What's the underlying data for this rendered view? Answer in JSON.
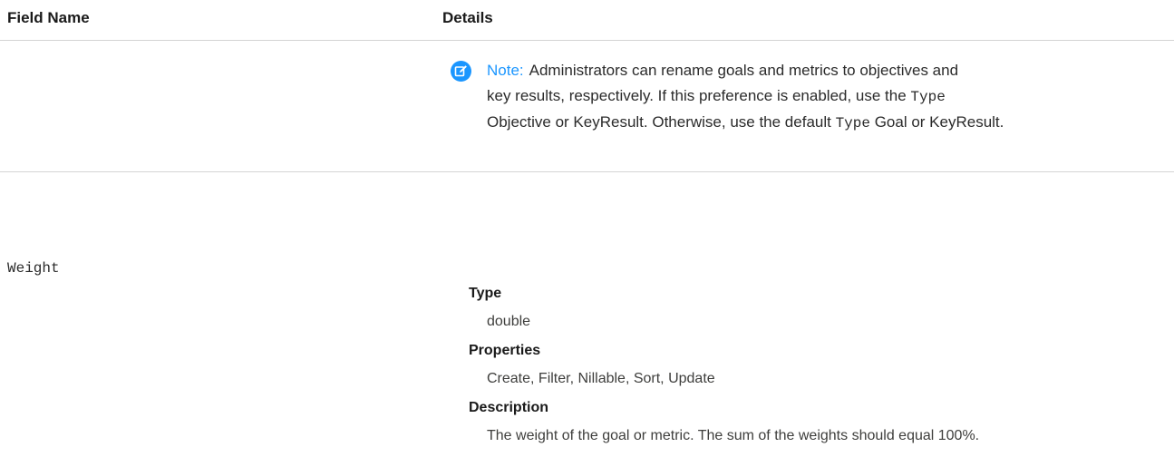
{
  "header": {
    "field_name": "Field Name",
    "details": "Details"
  },
  "note": {
    "label": "Note:",
    "line1": "Administrators can rename goals and metrics to objectives and",
    "line2a": "key results, respectively. If this preference is enabled, use the ",
    "line2_code": "Type",
    "line3a": "Objective or KeyResult. Otherwise, use the default ",
    "line3_code": "Type",
    "line3b": " Goal or KeyResult."
  },
  "field": {
    "name": "Weight",
    "type_label": "Type",
    "type_value": "double",
    "properties_label": "Properties",
    "properties_value": "Create, Filter, Nillable, Sort, Update",
    "description_label": "Description",
    "description_value": "The weight of the goal or metric. The sum of the weights should equal 100%."
  }
}
